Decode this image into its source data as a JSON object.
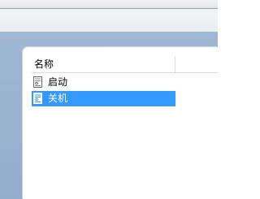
{
  "table": {
    "header": {
      "name_label": "名称"
    },
    "rows": [
      {
        "label": "启动",
        "icon": "task-script-icon",
        "selected": false
      },
      {
        "label": "关机",
        "icon": "task-script-icon",
        "selected": true
      }
    ]
  },
  "colors": {
    "selection": "#3399ff",
    "frame": "#9fb8d3"
  }
}
